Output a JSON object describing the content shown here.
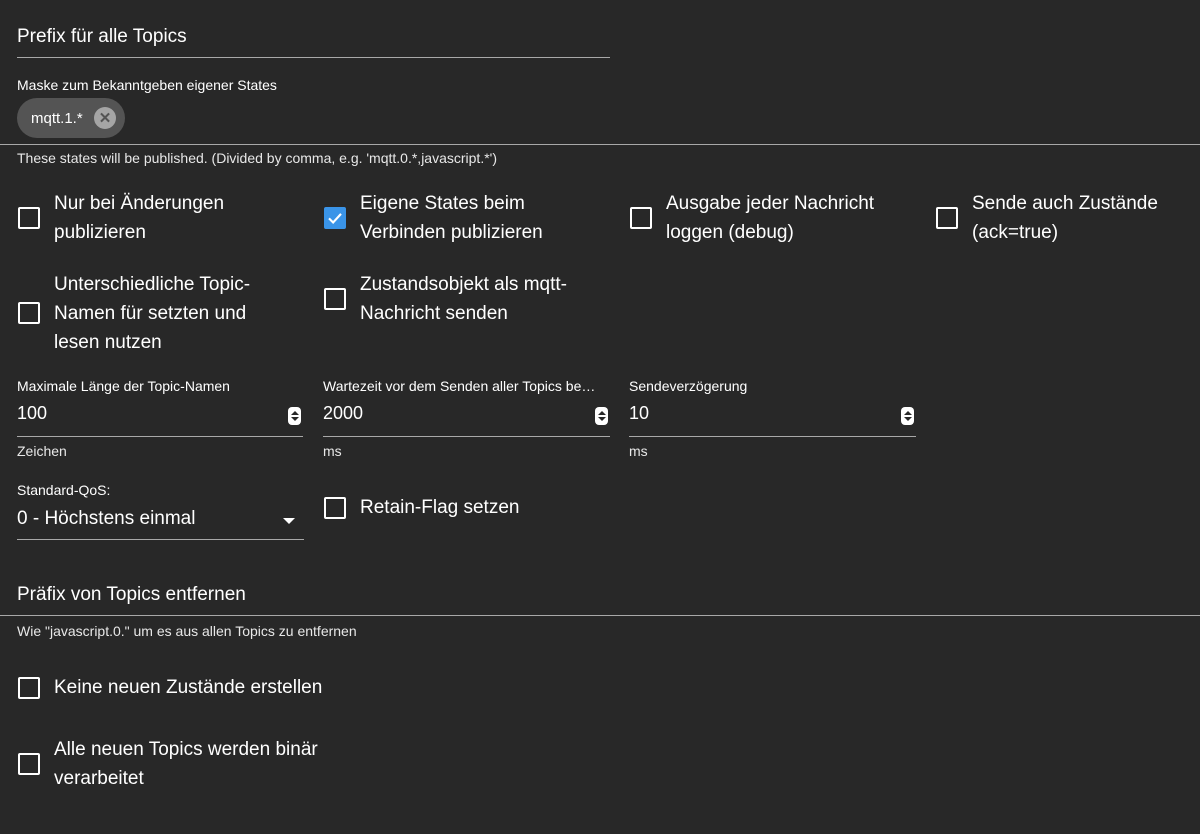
{
  "prefix": {
    "label": "Prefix für alle Topics"
  },
  "mask": {
    "label": "Maske zum Bekanntgeben eigener States",
    "chip": "mqtt.1.*",
    "helper": "These states will be published. (Divided by comma, e.g. 'mqtt.0.*,javascript.*')"
  },
  "checkboxes": {
    "only_changes": {
      "line1": "Nur bei Änderungen",
      "line2": "publizieren",
      "checked": false
    },
    "publish_on_connect": {
      "line1": "Eigene States beim",
      "line2": "Verbinden publizieren",
      "checked": true
    },
    "log_each_message": {
      "line1": "Ausgabe jeder Nachricht",
      "line2": "loggen (debug)",
      "checked": false
    },
    "send_ack_true": {
      "line1": "Sende auch Zustände",
      "line2": "(ack=true)",
      "checked": false
    },
    "different_topic_names": {
      "line1": "Unterschiedliche Topic-",
      "line2": "Namen für setzten und",
      "line3": "lesen nutzen",
      "checked": false
    },
    "state_object_as_message": {
      "line1": "Zustandsobjekt als mqtt-",
      "line2": "Nachricht senden",
      "checked": false
    },
    "retain_flag": {
      "label": "Retain-Flag setzen",
      "checked": false
    },
    "no_new_states": {
      "label": "Keine neuen Zustände erstellen",
      "checked": false
    },
    "binary_topics": {
      "line1": "Alle neuen Topics werden binär",
      "line2": "verarbeitet",
      "checked": false
    }
  },
  "max_topic_length": {
    "label": "Maximale Länge der Topic-Namen",
    "value": "100",
    "unit": "Zeichen"
  },
  "wait_before_send": {
    "label": "Wartezeit vor dem Senden aller Topics be…",
    "value": "2000",
    "unit": "ms"
  },
  "send_delay": {
    "label": "Sendeverzögerung",
    "value": "10",
    "unit": "ms"
  },
  "qos": {
    "label": "Standard-QoS:",
    "value": "0 - Höchstens einmal"
  },
  "remove_prefix": {
    "title": "Präfix von Topics entfernen",
    "helper": "Wie \"javascript.0.\" um es aus allen Topics zu entfernen"
  },
  "colors": {
    "background": "#282828",
    "accent": "#3a94e8",
    "chip": "#545454"
  }
}
